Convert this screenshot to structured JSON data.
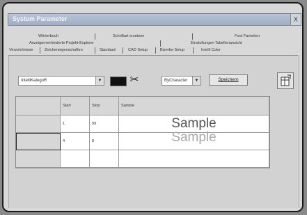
{
  "window": {
    "title": "System Parameter",
    "close_label": "X"
  },
  "tabs": {
    "row1": [
      "Wörterbuch",
      "Schriftart ersetzen",
      "Font Favoriten"
    ],
    "row2": [
      "Anzeigenverhinderte Projekt-Explorer",
      "Einstellungen Tabellenansicht"
    ],
    "row3": [
      "Verzeichnisse",
      "Zeicheneigenschaften",
      "Standard",
      "CAD Setup",
      "Bizerbe Setup",
      "Intelli Color"
    ]
  },
  "toolbar": {
    "intelli_combo_value": "IntelliKategoR",
    "mode_combo_value": "ByCharacter",
    "save_label": "Speichern",
    "swatch_color": "#111111"
  },
  "table": {
    "columns": [
      "Start",
      "Stop",
      "Sample"
    ],
    "rows": [
      {
        "start": "1",
        "stop": "99",
        "sample": "Sample",
        "color": "#555555"
      },
      {
        "start": "4",
        "stop": "8",
        "sample": "Sample",
        "color": "#a7a7a7"
      },
      {
        "start": "",
        "stop": "",
        "sample": ""
      }
    ]
  }
}
